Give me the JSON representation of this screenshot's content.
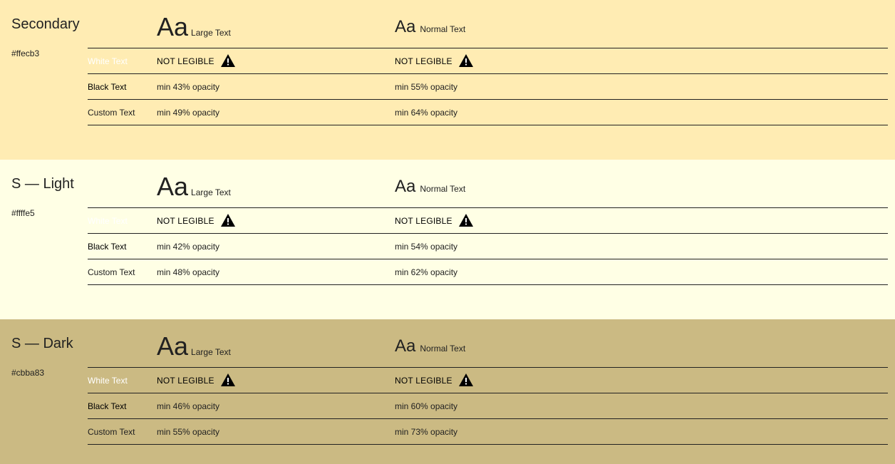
{
  "columns": {
    "large_aa": "Aa",
    "large_label": "Large Text",
    "normal_aa": "Aa",
    "normal_label": "Normal Text"
  },
  "sections": [
    {
      "title": "Secondary",
      "hex": "#ffecb3",
      "background": "#ffecb3",
      "rows": [
        {
          "label": "White Text",
          "label_color": "#ffffff",
          "large": "NOT LEGIBLE",
          "normal": "NOT LEGIBLE",
          "warning": true
        },
        {
          "label": "Black Text",
          "label_color": "#000000",
          "large": "min 43% opacity",
          "normal": "min 55% opacity"
        },
        {
          "label": "Custom Text",
          "label_color": "#212121",
          "large": "min 49% opacity",
          "normal": "min 64% opacity"
        }
      ]
    },
    {
      "title": "S — Light",
      "hex": "#ffffe5",
      "background": "#ffffe5",
      "rows": [
        {
          "label": "White Text",
          "label_color": "#ffffff",
          "large": "NOT LEGIBLE",
          "normal": "NOT LEGIBLE",
          "warning": true
        },
        {
          "label": "Black Text",
          "label_color": "#000000",
          "large": "min 42% opacity",
          "normal": "min 54% opacity"
        },
        {
          "label": "Custom Text",
          "label_color": "#212121",
          "large": "min 48% opacity",
          "normal": "min 62% opacity"
        }
      ]
    },
    {
      "title": "S — Dark",
      "hex": "#cbba83",
      "background": "#cbba83",
      "rows": [
        {
          "label": "White Text",
          "label_color": "#ffffff",
          "large": "NOT LEGIBLE",
          "normal": "NOT LEGIBLE",
          "warning": true
        },
        {
          "label": "Black Text",
          "label_color": "#000000",
          "large": "min 46% opacity",
          "normal": "min 60% opacity"
        },
        {
          "label": "Custom Text",
          "label_color": "#212121",
          "large": "min 55% opacity",
          "normal": "min 73% opacity"
        }
      ]
    }
  ]
}
